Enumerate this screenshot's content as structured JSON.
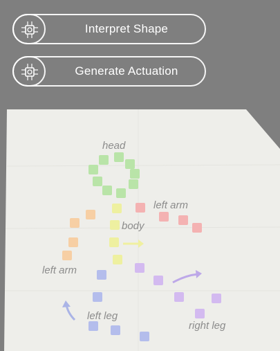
{
  "toolbar": {
    "interpret_label": "Interpret Shape",
    "actuation_label": "Generate Actuation",
    "icon": "chip-icon"
  },
  "scene": {
    "labels": {
      "head": "head",
      "left_arm_upper": "left arm",
      "body": "body",
      "left_arm_lower": "left arm",
      "left_leg": "left leg",
      "right_leg": "right leg"
    }
  },
  "colors": {
    "background": "#7f7f7f",
    "mat": "#eeeeea",
    "head": "#b9e4a8",
    "arm_red": "#f4b2b2",
    "body_yellow": "#eef0a0",
    "arm_orange": "#f7cfa4",
    "legs_blue": "#b4bdec",
    "legs_purple": "#d3baf0"
  }
}
